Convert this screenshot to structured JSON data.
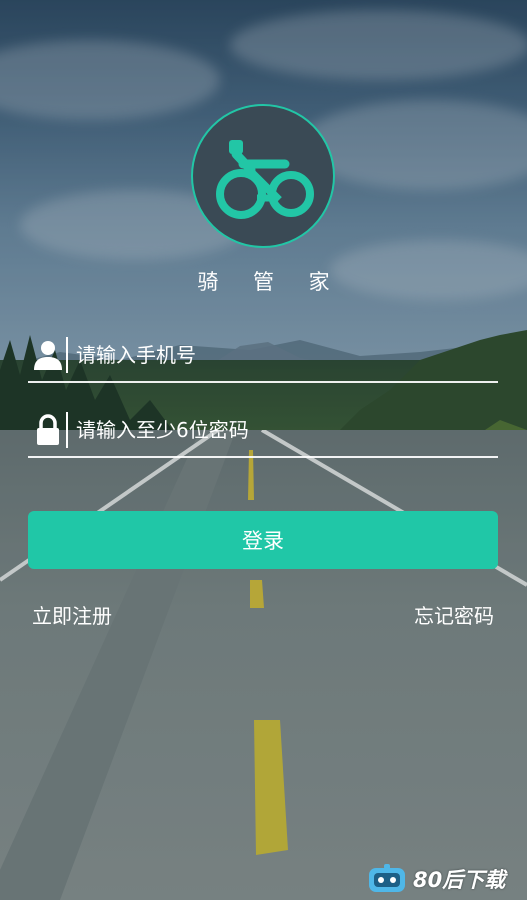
{
  "app": {
    "name": "骑 管 家"
  },
  "login_form": {
    "phone_placeholder": "请输入手机号",
    "password_placeholder": "请输入至少6位密码",
    "login_label": "登录",
    "register_label": "立即注册",
    "forgot_label": "忘记密码"
  },
  "icons": {
    "logo": "bicycle-icon",
    "phone_field": "user-icon",
    "password_field": "lock-icon",
    "watermark": "robot-icon"
  },
  "colors": {
    "accent": "#20c7a7",
    "logo_bg": "#3a4a55",
    "text": "#ffffff"
  },
  "watermark": {
    "text": "80后下载"
  }
}
